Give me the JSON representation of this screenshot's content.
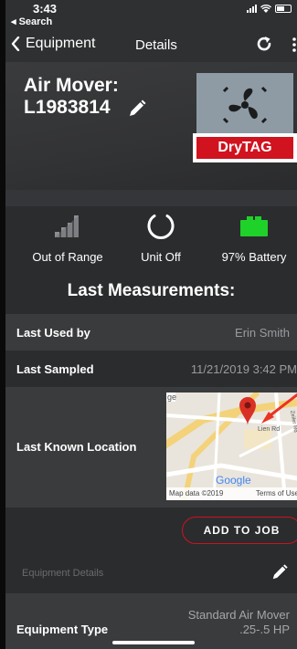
{
  "status_bar": {
    "time": "3:43",
    "back_app": "◂ Search"
  },
  "nav": {
    "back_label": "Equipment",
    "title": "Details"
  },
  "equipment": {
    "name_line1": "Air Mover:",
    "name_line2": "L1983814",
    "brand_tag": "DryTAG"
  },
  "status_items": [
    {
      "label": "Out of Range",
      "icon": "signal-bars-icon"
    },
    {
      "label": "Unit Off",
      "icon": "power-ring-icon"
    },
    {
      "label": "97% Battery",
      "icon": "battery-icon"
    }
  ],
  "measurements": {
    "title": "Last Measurements:",
    "rows": [
      {
        "label": "Last Used by",
        "value": "Erin Smith"
      },
      {
        "label": "Last Sampled",
        "value": "11/21/2019 3:42 PM"
      },
      {
        "label": "Last Known Location",
        "value": ""
      }
    ]
  },
  "map": {
    "road_label": "Lien Rd",
    "road_label2": "Zeiler Rd",
    "partial_label": "ge",
    "logo": "Google",
    "footer_left": "Map data ©2019",
    "footer_right": "Terms of Use"
  },
  "actions": {
    "add_to_job": "ADD TO JOB"
  },
  "details_section": {
    "title": "Equipment Details"
  },
  "equipment_type": {
    "label": "Equipment Type",
    "value_line1": "Standard Air Mover",
    "value_line2": ".25-.5 HP"
  },
  "colors": {
    "accent_red": "#d1121f",
    "battery_green": "#1fd22a"
  }
}
